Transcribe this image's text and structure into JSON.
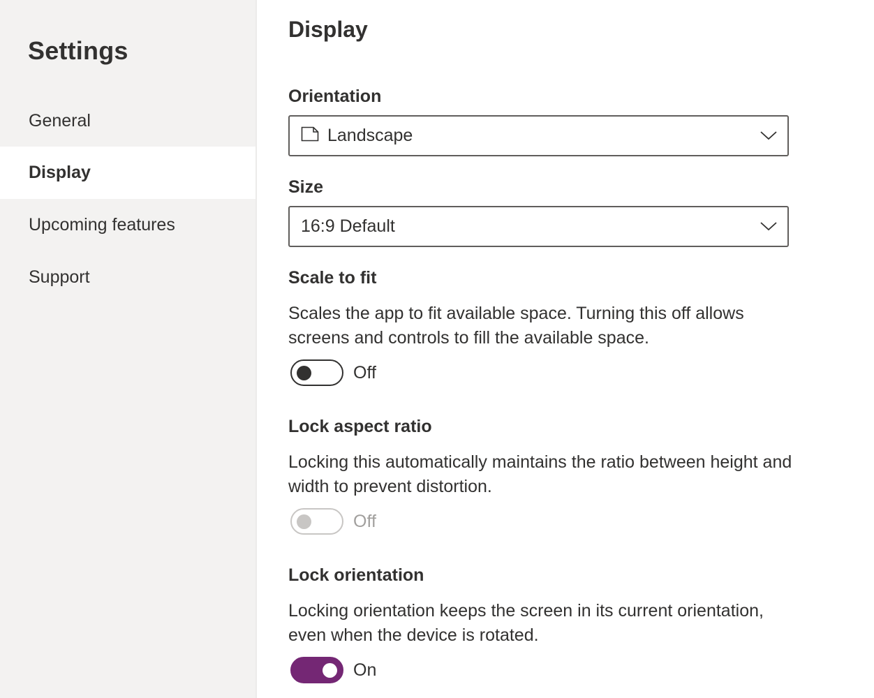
{
  "sidebar": {
    "title": "Settings",
    "items": [
      {
        "label": "General",
        "selected": false
      },
      {
        "label": "Display",
        "selected": true
      },
      {
        "label": "Upcoming features",
        "selected": false
      },
      {
        "label": "Support",
        "selected": false
      }
    ]
  },
  "main": {
    "title": "Display",
    "orientation": {
      "label": "Orientation",
      "value": "Landscape",
      "icon": "page-landscape-icon"
    },
    "size": {
      "label": "Size",
      "value": "16:9 Default"
    },
    "scale_to_fit": {
      "label": "Scale to fit",
      "description": "Scales the app to fit available space. Turning this off allows screens and controls to fill the available space.",
      "state": "Off",
      "enabled": true
    },
    "lock_aspect_ratio": {
      "label": "Lock aspect ratio",
      "description": "Locking this automatically maintains the ratio between height and width to prevent distortion.",
      "state": "Off",
      "enabled": false
    },
    "lock_orientation": {
      "label": "Lock orientation",
      "description": "Locking orientation keeps the screen in its current orientation, even when the device is rotated.",
      "state": "On",
      "enabled": true
    }
  },
  "colors": {
    "sidebar_bg": "#f3f2f1",
    "accent": "#742774",
    "text": "#323130",
    "disabled": "#c8c6c4"
  }
}
